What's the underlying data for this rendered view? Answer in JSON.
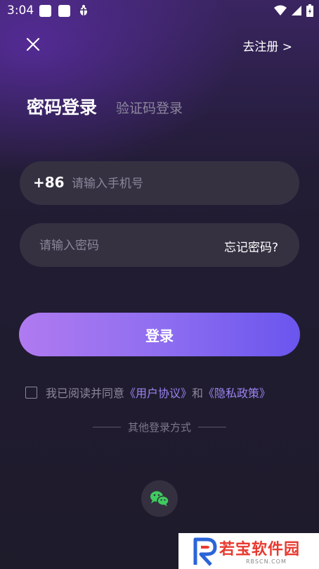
{
  "status_bar": {
    "time": "3:04",
    "left_icons": [
      "square-notification-icon",
      "square-notification-icon",
      "bug-icon"
    ],
    "right_icons": [
      "wifi-icon",
      "signal-icon",
      "battery-icon"
    ]
  },
  "header": {
    "close_icon": "close-icon",
    "register_link": "去注册 >"
  },
  "tabs": {
    "active": "密码登录",
    "inactive": "验证码登录"
  },
  "form": {
    "country_code": "+86",
    "phone_placeholder": "请输入手机号",
    "password_placeholder": "请输入密码",
    "forgot_password": "忘记密码?"
  },
  "login_button": "登录",
  "agreement": {
    "prefix": "我已阅读并同意",
    "user_agreement": "《用户协议》",
    "conjunction": "和",
    "privacy_policy": "《隐私政策》",
    "checked": false
  },
  "other_login": {
    "label": "其他登录方式",
    "methods": [
      "wechat-icon"
    ]
  },
  "watermark": {
    "brand": "若宝软件园",
    "sub": "RBSCN.COM"
  },
  "colors": {
    "accent_start": "#b07af0",
    "accent_end": "#6a55ee",
    "link": "#9b85f0",
    "wechat_green": "#3fcb5f",
    "watermark_red": "#e8392f",
    "watermark_blue": "#2b64d8"
  }
}
